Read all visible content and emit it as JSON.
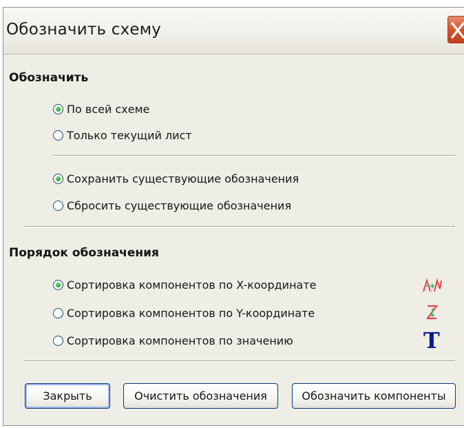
{
  "window": {
    "title": "Обозначить схему"
  },
  "annotate": {
    "heading": "Обозначить",
    "scope_options": [
      {
        "label": "По всей схеме",
        "selected": true
      },
      {
        "label": "Только текущий лист",
        "selected": false
      }
    ],
    "existing_options": [
      {
        "label": "Сохранить существующие обозначения",
        "selected": true
      },
      {
        "label": "Сбросить существующие обозначения",
        "selected": false
      }
    ]
  },
  "order": {
    "heading": "Порядок обозначения",
    "options": [
      {
        "label": "Сортировка компонентов по X-координате",
        "selected": true,
        "icon": "sort-x-icon"
      },
      {
        "label": "Сортировка компонентов по Y-координате",
        "selected": false,
        "icon": "sort-y-icon"
      },
      {
        "label": "Сортировка компонентов по значению",
        "selected": false,
        "icon": "sort-value-icon"
      }
    ]
  },
  "buttons": {
    "close": "Закрыть",
    "clear": "Очистить обозначения",
    "annotate": "Обозначить компоненты"
  },
  "icon_glyphs": {
    "value_sort": "T"
  },
  "colors": {
    "radio_selected": "#2fa62f",
    "close_button": "#d5532e",
    "value_icon": "#0a1a8c",
    "sort_icon_red": "#e2454a",
    "sort_icon_green": "#52b36a"
  }
}
